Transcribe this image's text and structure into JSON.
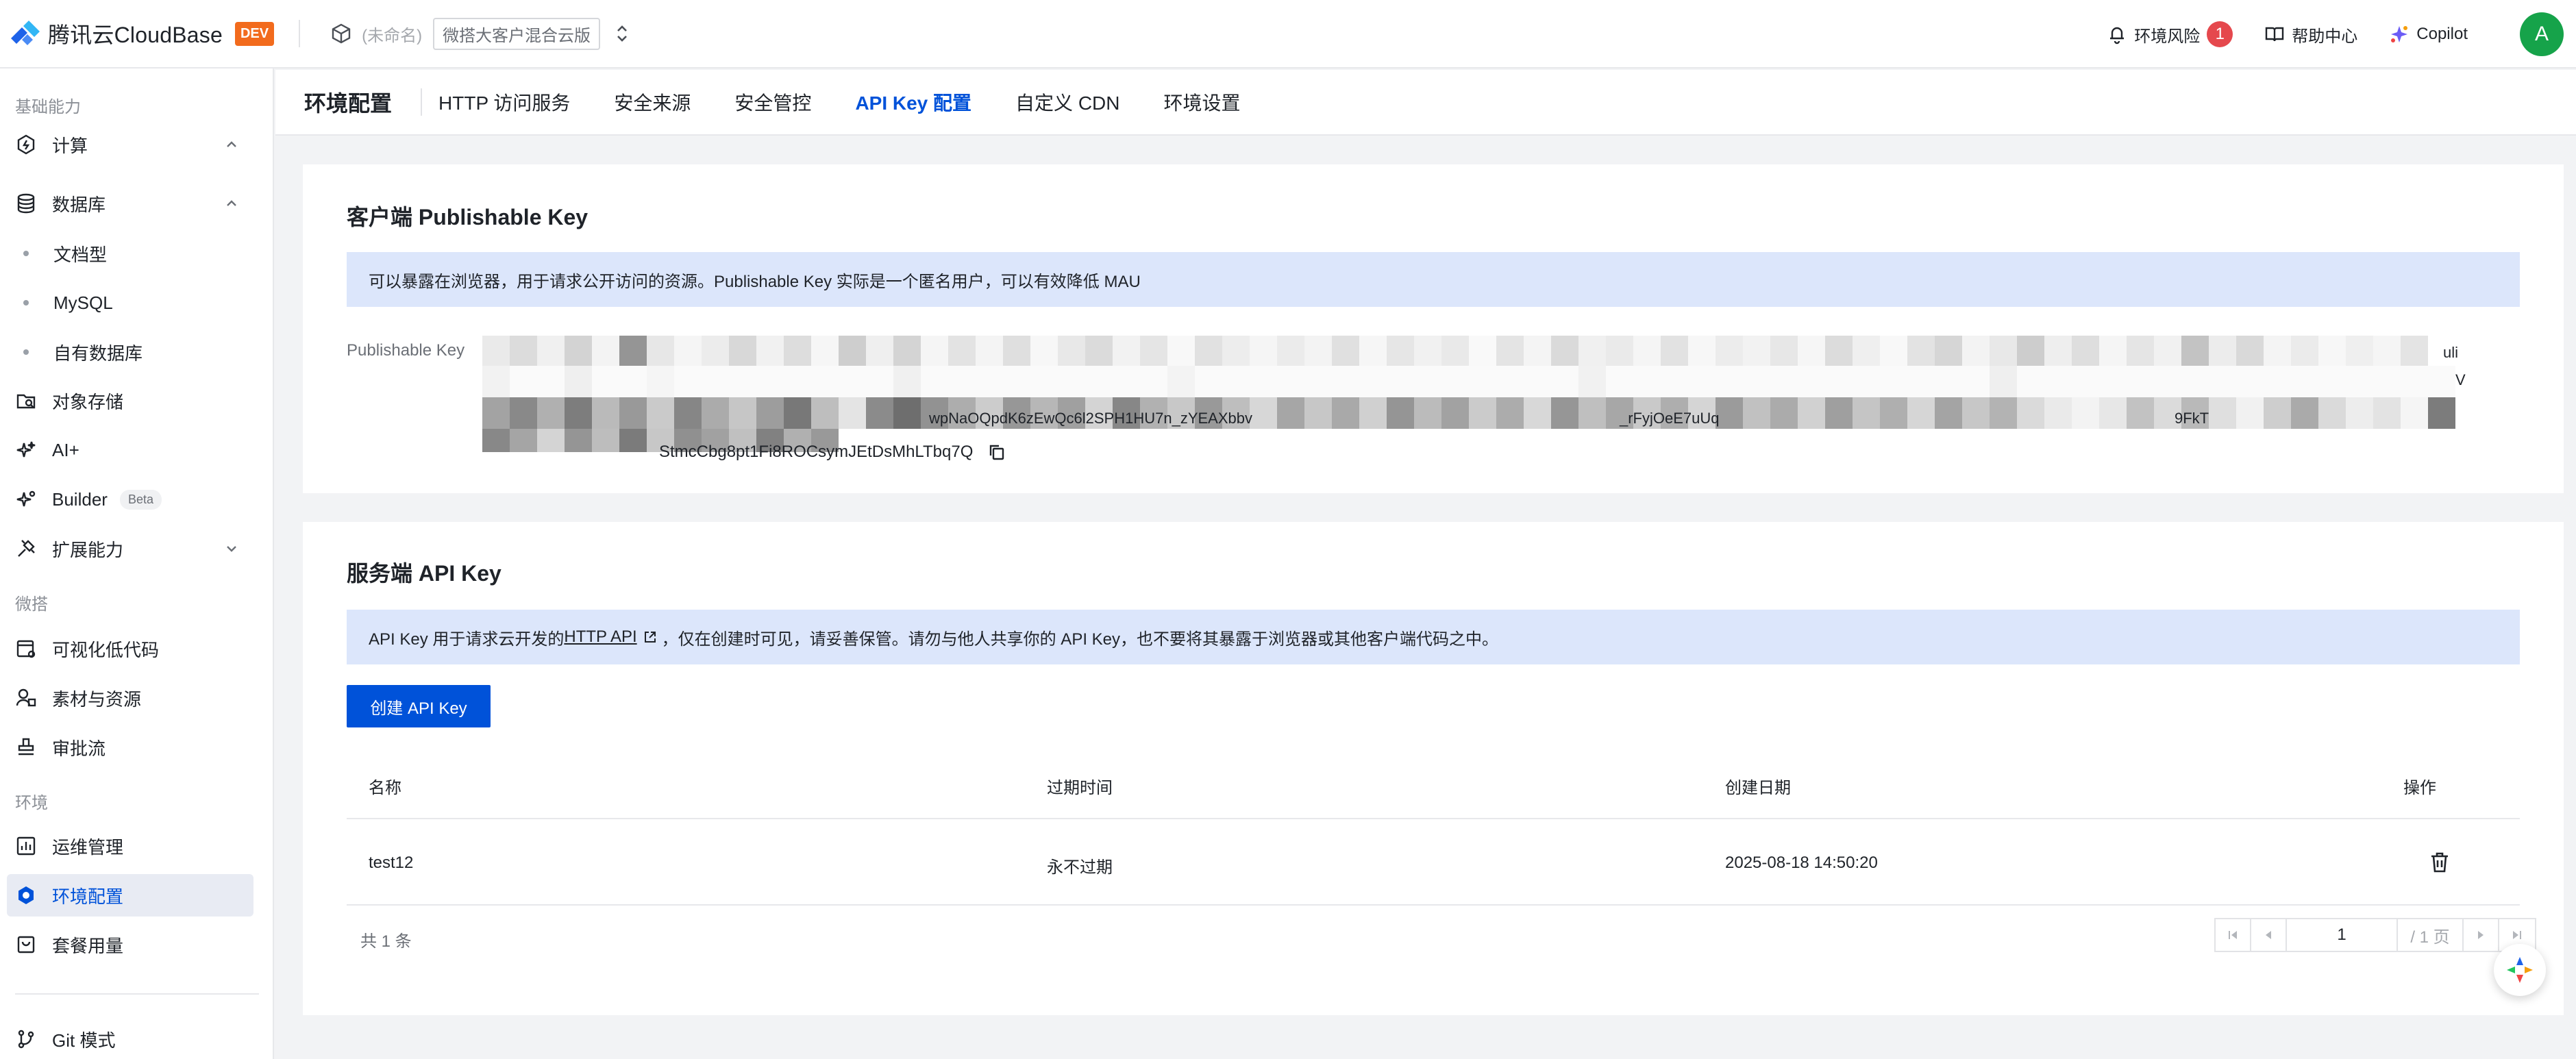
{
  "topbar": {
    "brand_text": "腾讯云CloudBase",
    "dev_badge": "DEV",
    "env_name": "(未命名)",
    "env_tag": "微搭大客户混合云版",
    "risk_label": "环境风险",
    "risk_count": "1",
    "help_label": "帮助中心",
    "copilot_label": "Copilot",
    "avatar_letter": "A"
  },
  "sidebar": {
    "section_basic": "基础能力",
    "compute": "计算",
    "database": "数据库",
    "db_sub": [
      "文档型",
      "MySQL",
      "自有数据库"
    ],
    "storage": "对象存储",
    "ai": "AI+",
    "builder": "Builder",
    "builder_badge": "Beta",
    "extension": "扩展能力",
    "section_weida": "微搭",
    "lowcode": "可视化低代码",
    "assets": "素材与资源",
    "approval": "审批流",
    "section_env": "环境",
    "ops": "运维管理",
    "env_config": "环境配置",
    "plan_usage": "套餐用量",
    "git_mode": "Git 模式"
  },
  "tabs": {
    "title": "环境配置",
    "items": [
      "HTTP 访问服务",
      "安全来源",
      "安全管控",
      "API Key 配置",
      "自定义 CDN",
      "环境设置"
    ],
    "active": "API Key 配置"
  },
  "publishable": {
    "title": "客户端 Publishable Key",
    "notice": "可以暴露在浏览器，用于请求公开访问的资源。Publishable Key 实际是一个匿名用户，可以有效降低 MAU",
    "label": "Publishable Key",
    "key_tail": "StmcCbg8pt1Fi8ROCsymJEtDsMhLTbq7Q",
    "frag_line1_end": "uli",
    "frag_line2_end": "V",
    "frag_line3_mid": "wpNaOQpdK6zEwQc6l2SPH1HU7n_zYEAXbbv",
    "frag_line3_b": "_rFyjOeE7uUq",
    "frag_line3_end": "9FkT"
  },
  "server": {
    "title": "服务端 API Key",
    "notice_pre": "API Key 用于请求云开发的",
    "notice_link": "HTTP API",
    "notice_post": "，仅在创建时可见，请妥善保管。请勿与他人共享你的 API Key，也不要将其暴露于浏览器或其他客户端代码之中。",
    "create_button": "创建 API Key",
    "columns": [
      "名称",
      "过期时间",
      "创建日期",
      "操作"
    ],
    "rows": [
      {
        "name": "test12",
        "expire": "永不过期",
        "created": "2025-08-18 14:50:20"
      }
    ],
    "total": "共 1 条",
    "page_value": "1",
    "page_total": "/ 1 页"
  },
  "colors": {
    "accent": "#0052d9",
    "notice_bg": "#dce6fb",
    "active_item_bg": "#e8ebf3",
    "dev_badge": "#f26b1d",
    "risk_badge": "#e5484d",
    "avatar": "#16a34a"
  },
  "icons": {
    "brand": "cloudbase-logo-icon",
    "env": "cube-icon",
    "switch": "up-down-arrows-icon",
    "risk": "bell-icon",
    "help": "book-icon",
    "copilot": "copilot-icon",
    "copy": "copy-icon",
    "delete": "trash-icon",
    "external": "external-link-icon"
  }
}
